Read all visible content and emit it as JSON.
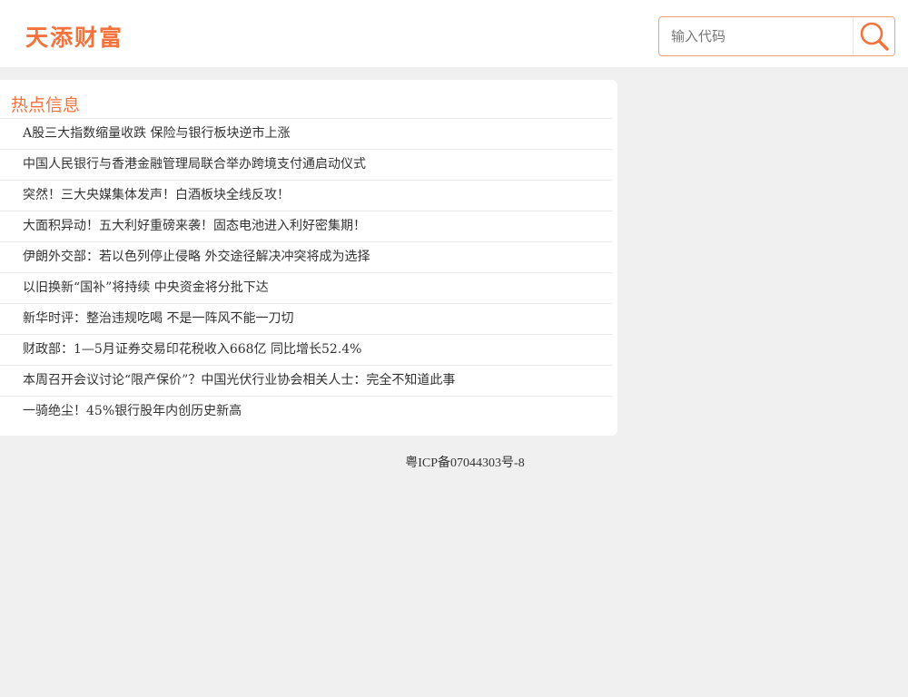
{
  "header": {
    "logo_text": "天添财富",
    "search": {
      "placeholder": "输入代码",
      "value": "",
      "button_icon": "search-icon"
    }
  },
  "hot_news": {
    "title": "热点信息",
    "items": [
      "A股三大指数缩量收跌 保险与银行板块逆市上涨",
      "中国人民银行与香港金融管理局联合举办跨境支付通启动仪式",
      "突然！三大央媒集体发声！白酒板块全线反攻！",
      "大面积异动！五大利好重磅来袭！固态电池进入利好密集期！",
      "伊朗外交部：若以色列停止侵略 外交途径解决冲突将成为选择",
      "以旧换新“国补”将持续 中央资金将分批下达",
      "新华时评：整治违规吃喝 不是一阵风不能一刀切",
      "财政部：1—5月证券交易印花税收入668亿 同比增长52.4%",
      "本周召开会议讨论“限产保价”？中国光伏行业协会相关人士：完全不知道此事",
      "一骑绝尘！45%银行股年内创历史新高"
    ]
  },
  "footer": {
    "icp": "粤ICP备07044303号-8"
  },
  "colors": {
    "accent": "#f4733d",
    "background": "#f0f0f0",
    "panel": "#ffffff"
  }
}
